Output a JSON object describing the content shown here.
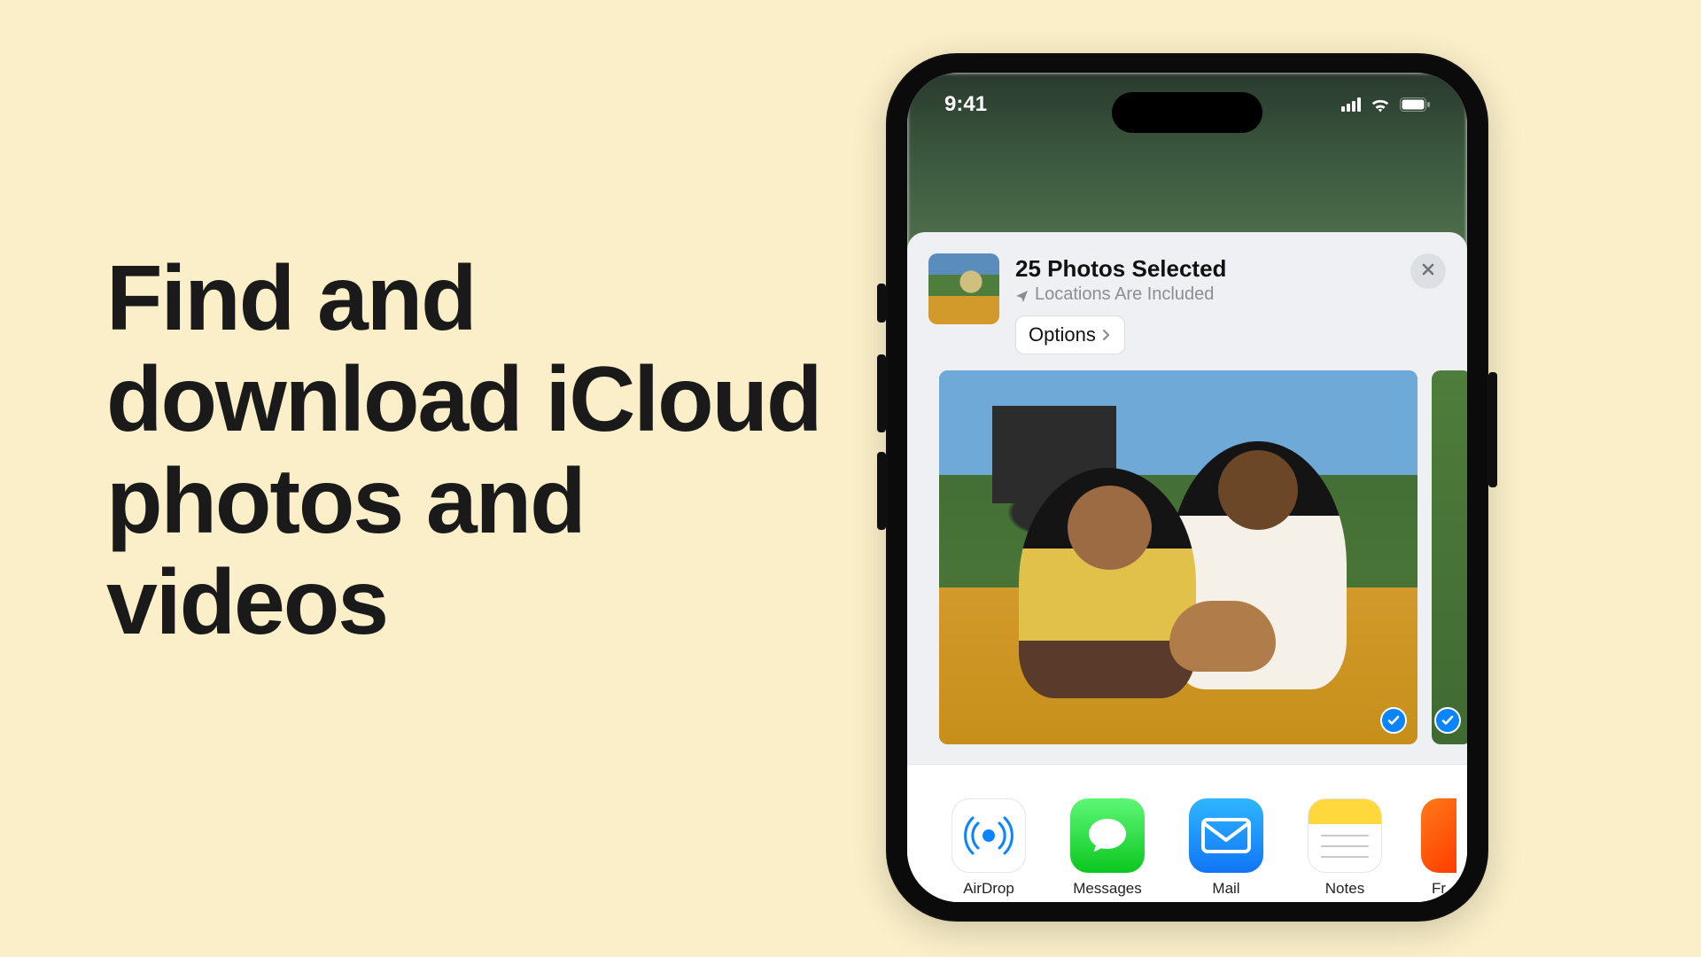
{
  "headline": "Find and download iCloud photos and videos",
  "statusBar": {
    "time": "9:41"
  },
  "shareSheet": {
    "title": "25 Photos Selected",
    "subtitle": "Locations Are Included",
    "optionsLabel": "Options"
  },
  "apps": [
    {
      "label": "AirDrop"
    },
    {
      "label": "Messages"
    },
    {
      "label": "Mail"
    },
    {
      "label": "Notes"
    },
    {
      "label": "Fr"
    }
  ]
}
